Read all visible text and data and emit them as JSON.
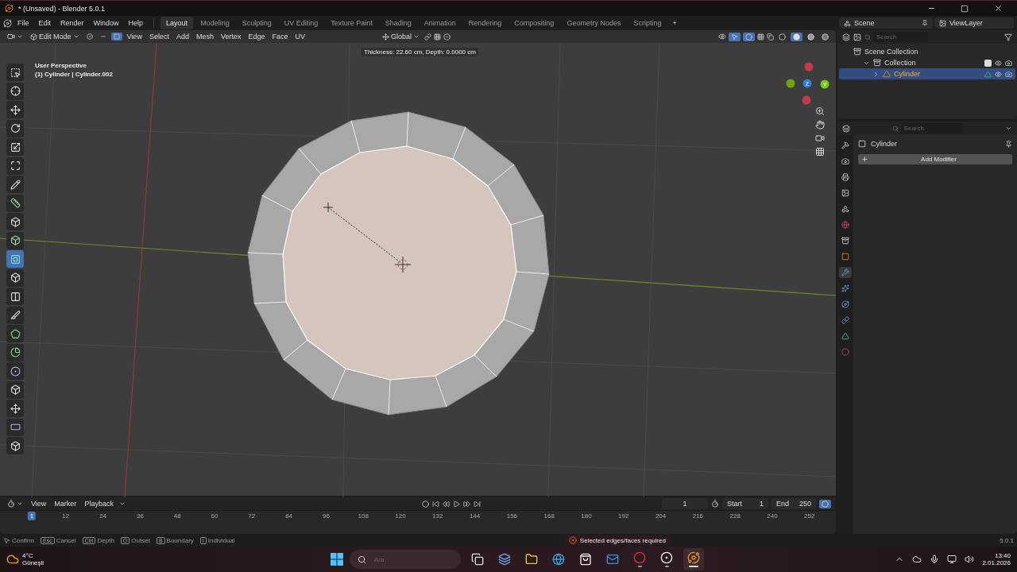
{
  "window": {
    "title": "* (Unsaved) - Blender 5.0.1"
  },
  "menus": [
    "File",
    "Edit",
    "Render",
    "Window",
    "Help"
  ],
  "workspaces": [
    {
      "label": "Layout",
      "selected": true
    },
    {
      "label": "Modeling",
      "selected": false
    },
    {
      "label": "Sculpting",
      "selected": false
    },
    {
      "label": "UV Editing",
      "selected": false
    },
    {
      "label": "Texture Paint",
      "selected": false
    },
    {
      "label": "Shading",
      "selected": false
    },
    {
      "label": "Animation",
      "selected": false
    },
    {
      "label": "Rendering",
      "selected": false
    },
    {
      "label": "Compositing",
      "selected": false
    },
    {
      "label": "Geometry Nodes",
      "selected": false
    },
    {
      "label": "Scripting",
      "selected": false
    }
  ],
  "add_workspace": "+",
  "scene": "Scene",
  "view_layer": "ViewLayer",
  "viewport_header": {
    "mode": "Edit Mode",
    "select_modes": [
      {
        "kind": "vertex",
        "selected": false
      },
      {
        "kind": "edge",
        "selected": false
      },
      {
        "kind": "face",
        "selected": true
      }
    ],
    "menus": [
      "View",
      "Select",
      "Add",
      "Mesh",
      "Vertex",
      "Edge",
      "Face",
      "UV"
    ],
    "orientation": "Global",
    "shading": [
      {
        "kind": "wireframe",
        "selected": false
      },
      {
        "kind": "solid",
        "selected": true
      },
      {
        "kind": "material",
        "selected": false
      },
      {
        "kind": "rendered",
        "selected": false
      }
    ]
  },
  "operator_info": "Thickness: 22.60 cm, Depth: 0.0000 cm",
  "viewport": {
    "view_name": "User Perspective",
    "object_info": "(1) Cylinder | Cylinder.002"
  },
  "gizmo": [
    {
      "color": "#c33a4a"
    },
    {
      "color": "#6ea30f"
    },
    {
      "color": "#2f7dde",
      "label": "Z"
    },
    {
      "color": "#7cc51a",
      "label": "Y"
    },
    {
      "color": "#c33a4a"
    }
  ],
  "tools": [
    {
      "kind": "select_box",
      "selected": false
    },
    {
      "kind": "cursor",
      "selected": false
    },
    {
      "kind": "move",
      "selected": false
    },
    {
      "kind": "rotate",
      "selected": false
    },
    {
      "kind": "scale",
      "selected": false
    },
    {
      "kind": "transform",
      "selected": false
    },
    {
      "kind": "annotate",
      "selected": false
    },
    {
      "kind": "measure",
      "selected": false
    },
    {
      "kind": "add_cube",
      "selected": false
    },
    {
      "kind": "extrude",
      "selected": false
    },
    {
      "kind": "inset",
      "selected": true
    },
    {
      "kind": "bevel",
      "selected": false
    },
    {
      "kind": "loop_cut",
      "selected": false
    },
    {
      "kind": "knife",
      "selected": false
    },
    {
      "kind": "poly_build",
      "selected": false
    },
    {
      "kind": "spin",
      "selected": false
    },
    {
      "kind": "smooth",
      "selected": false
    },
    {
      "kind": "edge_slide",
      "selected": false
    },
    {
      "kind": "shrink",
      "selected": false
    },
    {
      "kind": "shear",
      "selected": false
    },
    {
      "kind": "rip",
      "selected": false
    }
  ],
  "outliner": {
    "search": {
      "placeholder": "Search"
    },
    "tree": [
      {
        "label": "Scene Collection",
        "kind": "scene_collection",
        "selected": false,
        "children": [
          {
            "label": "Collection",
            "kind": "collection",
            "selected": false,
            "expanded": true,
            "checked": true,
            "children": [
              {
                "label": "Cylinder",
                "kind": "mesh_object",
                "selected": true,
                "expanded": false
              }
            ]
          }
        ]
      }
    ]
  },
  "properties": {
    "search": {
      "placeholder": "Search"
    },
    "object": "Cylinder",
    "add_button": "Add Modifier",
    "tabs": [
      {
        "kind": "tool",
        "selected": false
      },
      {
        "kind": "render",
        "selected": false
      },
      {
        "kind": "output",
        "selected": false
      },
      {
        "kind": "view_layer",
        "selected": false
      },
      {
        "kind": "scene",
        "selected": false
      },
      {
        "kind": "world",
        "selected": false
      },
      {
        "kind": "collection",
        "selected": false
      },
      {
        "kind": "object",
        "selected": false
      },
      {
        "kind": "modifier",
        "selected": true
      },
      {
        "kind": "particles",
        "selected": false
      },
      {
        "kind": "physics",
        "selected": false
      },
      {
        "kind": "constraints",
        "selected": false
      },
      {
        "kind": "data",
        "selected": false
      },
      {
        "kind": "material",
        "selected": false
      }
    ]
  },
  "timeline": {
    "menus": [
      "View",
      "Marker",
      "Playback"
    ],
    "current_frame": "1",
    "start_label": "Start",
    "start": "1",
    "end_label": "End",
    "end": "250",
    "playhead": "1",
    "ticks": [
      "12",
      "24",
      "36",
      "48",
      "60",
      "72",
      "84",
      "96",
      "108",
      "120",
      "132",
      "144",
      "156",
      "168",
      "180",
      "192",
      "204",
      "216",
      "228",
      "240",
      "252"
    ]
  },
  "status_bar": {
    "hints": [
      {
        "kind": "mouse",
        "label": "Confirm"
      },
      {
        "kind": "key",
        "key": "Esc",
        "label": "Cancel"
      },
      {
        "kind": "key",
        "key": "Ctrl",
        "label": "Depth"
      },
      {
        "kind": "key",
        "key": "O",
        "label": "Outset"
      },
      {
        "kind": "key",
        "key": "B",
        "label": "Boundary"
      },
      {
        "kind": "key",
        "key": "I",
        "label": "Individual"
      }
    ],
    "error": "Selected edges/faces required",
    "version": "5.0.1"
  },
  "taskbar": {
    "weather": {
      "temperature": "4°C",
      "condition": "Güneşli"
    },
    "search": {
      "placeholder": "Ara"
    },
    "apps": [
      {
        "kind": "task_view",
        "running": false,
        "active": false
      },
      {
        "kind": "copilot",
        "running": false,
        "active": false
      },
      {
        "kind": "explorer",
        "running": false,
        "active": false
      },
      {
        "kind": "edge",
        "running": false,
        "active": false
      },
      {
        "kind": "store",
        "running": false,
        "active": false
      },
      {
        "kind": "mail",
        "running": false,
        "active": false
      },
      {
        "kind": "opera",
        "running": true,
        "active": false
      },
      {
        "kind": "obs",
        "running": true,
        "active": false
      },
      {
        "kind": "blender",
        "running": true,
        "active": true
      }
    ],
    "time": "13:40",
    "date": "2.01.2026"
  }
}
